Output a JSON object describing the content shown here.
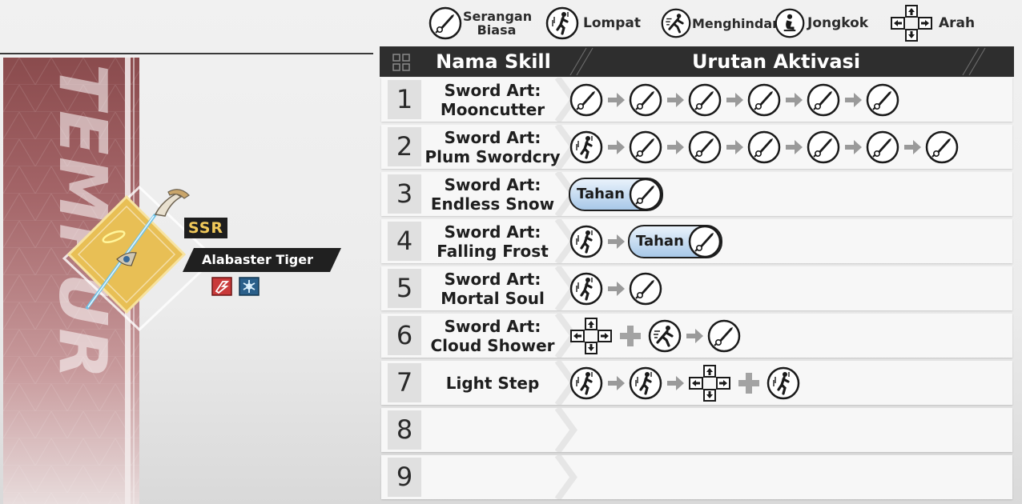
{
  "legend": {
    "items": [
      {
        "icon": "sword-attack-icon",
        "label": "Serangan Biasa"
      },
      {
        "icon": "jump-icon",
        "label": "Lompat"
      },
      {
        "icon": "dodge-icon",
        "label": "Menghindar"
      },
      {
        "icon": "crouch-icon",
        "label": "Jongkok"
      },
      {
        "icon": "direction-pad-icon",
        "label": "Arah"
      }
    ],
    "serangan_line1": "Serangan",
    "serangan_line2": "Biasa"
  },
  "banner": {
    "text": "SKILL TEMPUR"
  },
  "weapon": {
    "rarity": "SSR",
    "name": "Alabaster Tiger",
    "element_icons": [
      "physical-element-icon",
      "ice-element-icon"
    ],
    "colors": {
      "rarity_text": "#f1c95a",
      "diamond": "#e8bf55"
    }
  },
  "table": {
    "header_skill": "Nama Skill",
    "header_sequence": "Urutan Aktivasi",
    "rows": [
      {
        "num": "1",
        "name_line1": "Sword Art:",
        "name_line2": "Mooncutter",
        "sequence": [
          "attack",
          "arrow",
          "attack",
          "arrow",
          "attack",
          "arrow",
          "attack",
          "arrow",
          "attack",
          "arrow",
          "attack"
        ]
      },
      {
        "num": "2",
        "name_line1": "Sword Art:",
        "name_line2": "Plum Swordcry",
        "sequence": [
          "jump",
          "arrow",
          "attack",
          "arrow",
          "attack",
          "arrow",
          "attack",
          "arrow",
          "attack",
          "arrow",
          "attack",
          "arrow",
          "attack"
        ]
      },
      {
        "num": "3",
        "name_line1": "Sword Art:",
        "name_line2": "Endless Snow",
        "sequence": [
          "hold-attack"
        ]
      },
      {
        "num": "4",
        "name_line1": "Sword Art:",
        "name_line2": "Falling Frost",
        "sequence": [
          "jump",
          "arrow",
          "hold-attack"
        ]
      },
      {
        "num": "5",
        "name_line1": "Sword Art:",
        "name_line2": "Mortal Soul",
        "sequence": [
          "jump",
          "arrow",
          "attack"
        ]
      },
      {
        "num": "6",
        "name_line1": "Sword Art:",
        "name_line2": "Cloud Shower",
        "sequence": [
          "dpad",
          "plus",
          "dodge",
          "arrow",
          "attack"
        ]
      },
      {
        "num": "7",
        "name_line1": "Light Step",
        "name_line2": "",
        "sequence": [
          "jump",
          "arrow",
          "jump",
          "arrow",
          "dpad",
          "plus",
          "jump"
        ]
      },
      {
        "num": "8",
        "name_line1": "",
        "name_line2": "",
        "sequence": []
      },
      {
        "num": "9",
        "name_line1": "",
        "name_line2": "",
        "sequence": []
      }
    ],
    "hold_label": "Tahan"
  }
}
